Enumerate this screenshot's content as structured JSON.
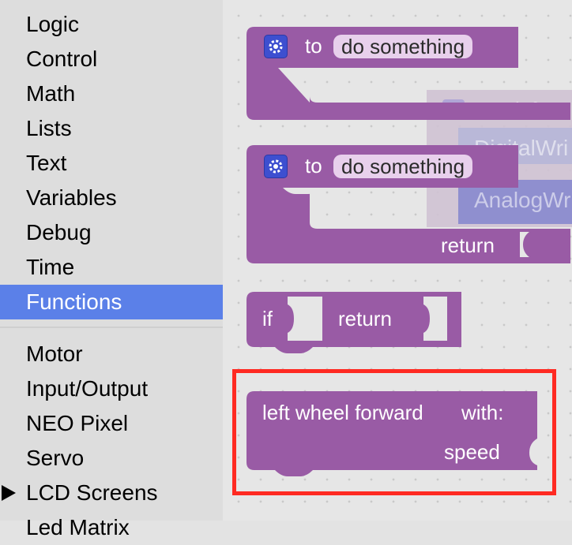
{
  "sidebar": {
    "categories": [
      {
        "label": "Logic"
      },
      {
        "label": "Control"
      },
      {
        "label": "Math"
      },
      {
        "label": "Lists"
      },
      {
        "label": "Text"
      },
      {
        "label": "Variables"
      },
      {
        "label": "Debug"
      },
      {
        "label": "Time"
      },
      {
        "label": "Functions",
        "selected": true
      },
      {
        "label": "Motor"
      },
      {
        "label": "Input/Output"
      },
      {
        "label": "NEO Pixel"
      },
      {
        "label": "Servo"
      },
      {
        "label": "LCD Screens"
      },
      {
        "label": "Led Matrix"
      }
    ]
  },
  "flyout": {
    "procedure_block": {
      "to_label": "to",
      "name": "do something",
      "icon": "gear-icon"
    },
    "procedure_return_block": {
      "to_label": "to",
      "name": "do something",
      "return_label": "return",
      "icon": "gear-icon"
    },
    "if_return_block": {
      "if_label": "if",
      "return_label": "return"
    },
    "call_block": {
      "label": "left wheel forward",
      "with_label": "with:",
      "param": "speed"
    }
  },
  "background_blocks": {
    "header": "left w",
    "row1": "DigitalWri",
    "row2": "AnalogWr"
  },
  "colors": {
    "block_purple": "#995ba5",
    "selected_category": "#5b80e8",
    "highlight": "#ff2a22"
  }
}
